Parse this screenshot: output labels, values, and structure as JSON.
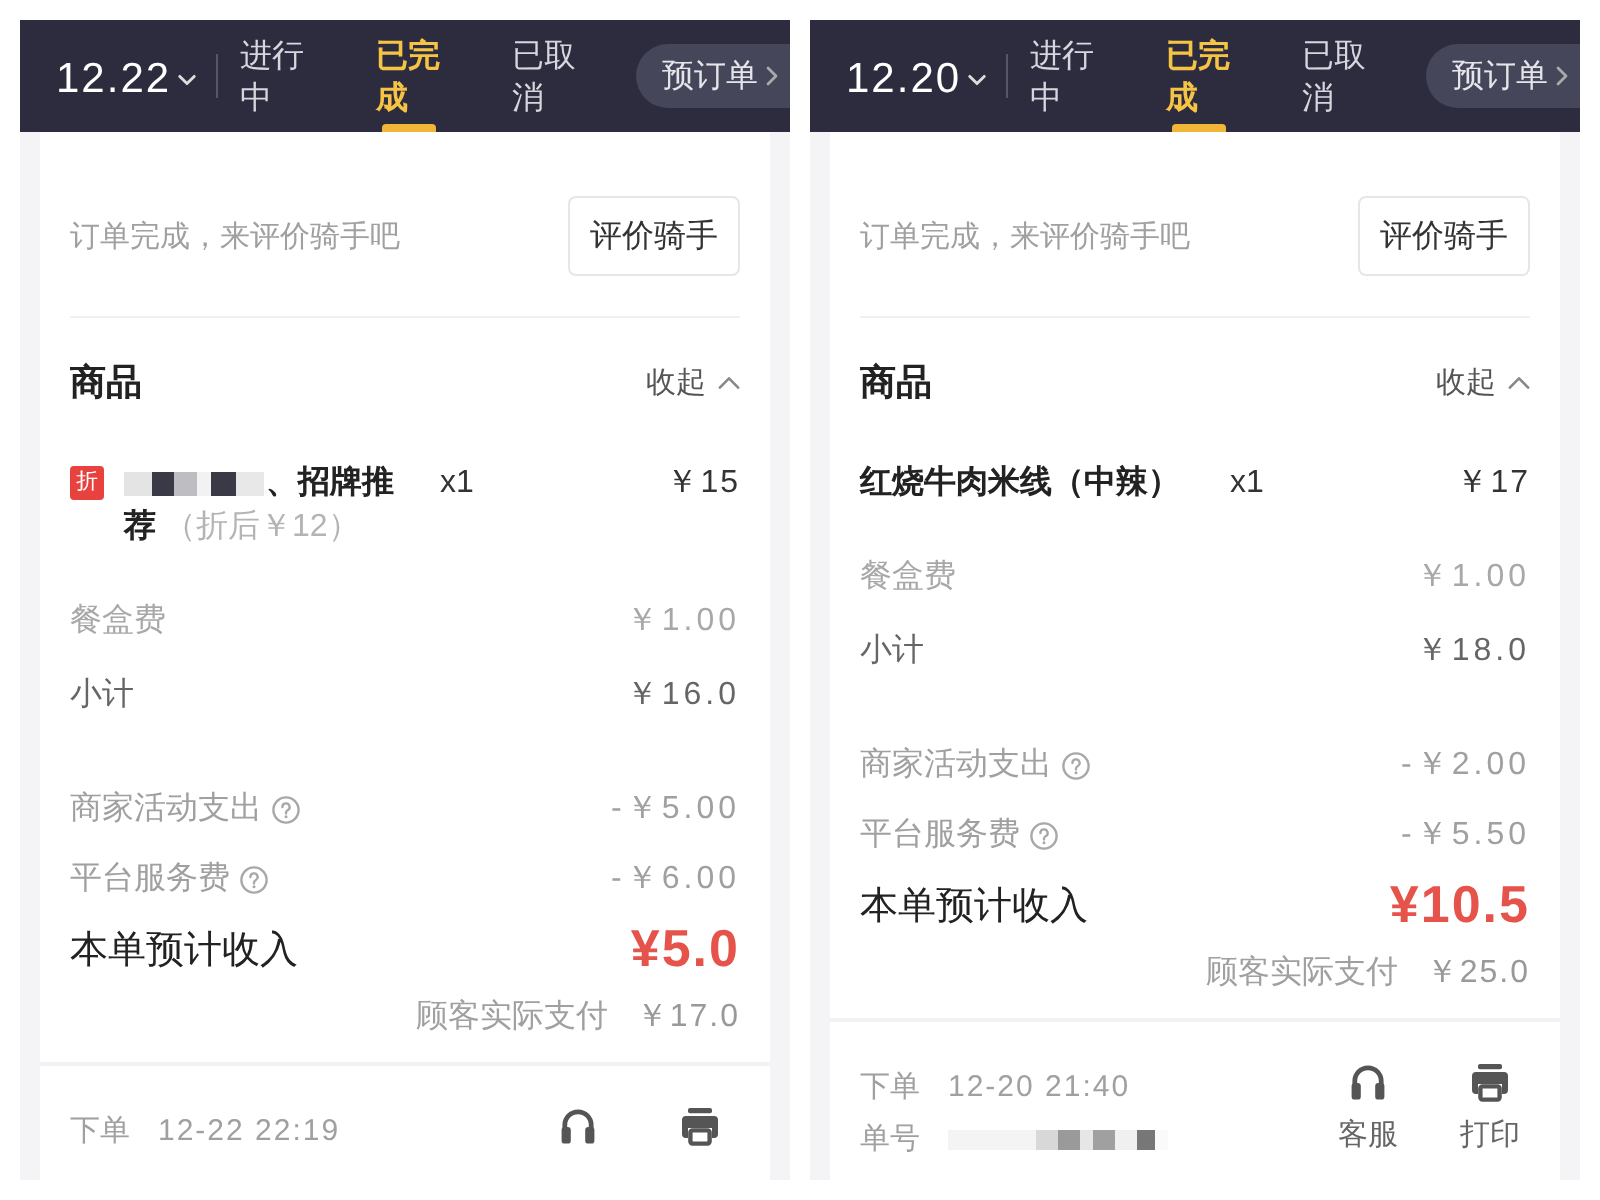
{
  "panels": [
    {
      "header": {
        "date": "12.22",
        "tabs": [
          {
            "label": "进行中",
            "selected": false
          },
          {
            "label": "已完成",
            "selected": true
          },
          {
            "label": "已取消",
            "selected": false
          }
        ],
        "preorder_button": "预订单"
      },
      "rate_prompt": "订单完成，来评价骑手吧",
      "rate_button": "评价骑手",
      "goods": {
        "title": "商品",
        "collapse_button": "收起",
        "items": [
          {
            "badge": "折",
            "name_redacted": true,
            "name": "、招牌推荐",
            "discount_note": "（折后￥12）",
            "quantity": "x1",
            "price": "￥15"
          }
        ]
      },
      "charges": [
        {
          "kind": "minor",
          "label": "餐盒费",
          "value": "￥1.00"
        },
        {
          "kind": "subtotal",
          "label": "小计",
          "value": "￥16.0"
        }
      ],
      "deductions": [
        {
          "label": "商家活动支出",
          "help": true,
          "value": "-￥5.00"
        },
        {
          "label": "平台服务费",
          "help": true,
          "value": "-￥6.00"
        }
      ],
      "income": {
        "label": "本单预计收入",
        "value": "¥5.0"
      },
      "customer_paid": {
        "label": "顾客实际支付",
        "value": "￥17.0"
      },
      "footer": {
        "order_time_label": "下单",
        "order_time": "12-22 22:19",
        "actions": [
          {
            "kind": "support"
          },
          {
            "kind": "print"
          }
        ]
      }
    },
    {
      "header": {
        "date": "12.20",
        "tabs": [
          {
            "label": "进行中",
            "selected": false
          },
          {
            "label": "已完成",
            "selected": true
          },
          {
            "label": "已取消",
            "selected": false
          }
        ],
        "preorder_button": "预订单"
      },
      "rate_prompt": "订单完成，来评价骑手吧",
      "rate_button": "评价骑手",
      "goods": {
        "title": "商品",
        "collapse_button": "收起",
        "items": [
          {
            "name": "红烧牛肉米线（中辣）",
            "quantity": "x1",
            "price": "￥17"
          }
        ]
      },
      "charges": [
        {
          "kind": "minor",
          "label": "餐盒费",
          "value": "￥1.00"
        },
        {
          "kind": "subtotal",
          "label": "小计",
          "value": "￥18.0"
        }
      ],
      "deductions": [
        {
          "label": "商家活动支出",
          "help": true,
          "value": "-￥2.00"
        },
        {
          "label": "平台服务费",
          "help": true,
          "value": "-￥5.50"
        }
      ],
      "income": {
        "label": "本单预计收入",
        "value": "¥10.5"
      },
      "customer_paid": {
        "label": "顾客实际支付",
        "value": "￥25.0"
      },
      "footer": {
        "order_time_label": "下单",
        "order_time": "12-20 21:40",
        "order_number_label": "单号",
        "order_number_redacted": true,
        "actions": [
          {
            "kind": "support",
            "label": "客服"
          },
          {
            "kind": "print",
            "label": "打印"
          }
        ]
      }
    }
  ]
}
